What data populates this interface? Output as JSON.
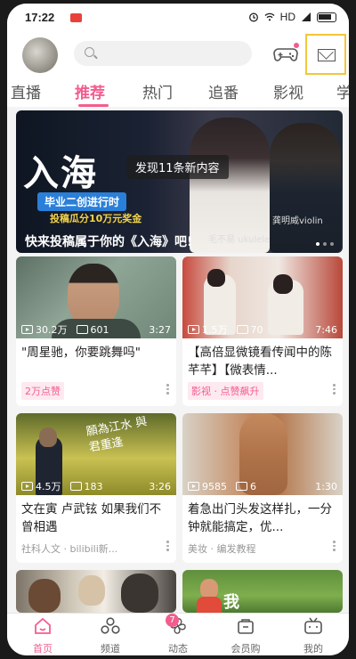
{
  "status_bar": {
    "time": "17:22",
    "network": "HD",
    "battery_label": "battery"
  },
  "header": {
    "search_placeholder": ""
  },
  "tabs": [
    {
      "label": "直播",
      "active": false
    },
    {
      "label": "推荐",
      "active": true
    },
    {
      "label": "热门",
      "active": false
    },
    {
      "label": "追番",
      "active": false
    },
    {
      "label": "影视",
      "active": false
    },
    {
      "label": "学",
      "active": false
    }
  ],
  "banner": {
    "big_title": "入海",
    "pill_text": "毕业二创进行时",
    "prize_text": "投稿瓜分10万元奖金",
    "toast": "发现11条新内容",
    "name_left": "毛不易 ukulele",
    "name_right": "龚明威violin",
    "caption": "快来投稿属于你的《入海》吧!"
  },
  "cards": [
    {
      "views": "30.2万",
      "comments": "601",
      "duration": "3:27",
      "title": "\"周星驰，你要跳舞吗\"",
      "tag": "2万点赞",
      "tag_type": "pink",
      "source": ""
    },
    {
      "views": "1.5万",
      "comments": "70",
      "duration": "7:46",
      "title": "【高倍显微镜看传闻中的陈芊芊】【微表情...",
      "tag": "影视 · 点赞飙升",
      "tag_type": "pink",
      "source": ""
    },
    {
      "views": "4.5万",
      "comments": "183",
      "duration": "3:26",
      "title": "文在寅 卢武铉 如果我们不曾相遇",
      "tag": "",
      "tag_type": "",
      "source": "社科人文 · bilibili新..."
    },
    {
      "views": "9585",
      "comments": "6",
      "duration": "1:30",
      "title": "着急出门头发这样扎，一分钟就能搞定，优...",
      "tag": "",
      "tag_type": "",
      "source": "美妆 · 编发教程"
    }
  ],
  "thumb_texts": {
    "card3_calligraphy": "願為江水 與君重逢",
    "card6_char": "我"
  },
  "bottom_nav": [
    {
      "label": "首页",
      "icon": "home-icon",
      "active": true
    },
    {
      "label": "频道",
      "icon": "channel-icon",
      "active": false
    },
    {
      "label": "动态",
      "icon": "dynamic-icon",
      "active": false,
      "badge": "7"
    },
    {
      "label": "会员购",
      "icon": "shop-icon",
      "active": false
    },
    {
      "label": "我的",
      "icon": "tv-icon",
      "active": false
    }
  ],
  "colors": {
    "accent": "#f25d8e",
    "highlight_box": "#f3c63a"
  }
}
